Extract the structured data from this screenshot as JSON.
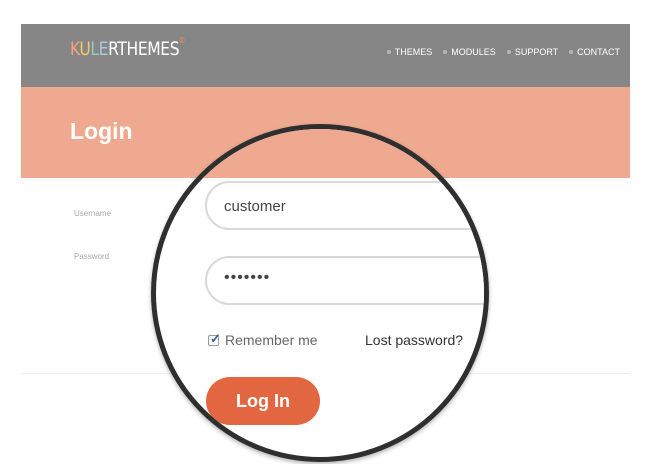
{
  "header": {
    "logo_text": "KULERTHEMES",
    "logo_mark": "®",
    "nav": [
      {
        "label": "THEMES"
      },
      {
        "label": "MODULES"
      },
      {
        "label": "SUPPORT"
      },
      {
        "label": "CONTACT"
      }
    ]
  },
  "page": {
    "title": "Login"
  },
  "form": {
    "username_label": "Username",
    "password_label": "Password",
    "username_value": "customer",
    "password_value": "•••••••",
    "remember_label": "Remember me",
    "remember_checked": true,
    "lost_password": "Lost password?",
    "submit_label": "Log In"
  },
  "colors": {
    "header_bg": "#868686",
    "banner_bg": "#eea990",
    "button_bg": "#e2663f",
    "checkbox_accent": "#2f62a6"
  }
}
